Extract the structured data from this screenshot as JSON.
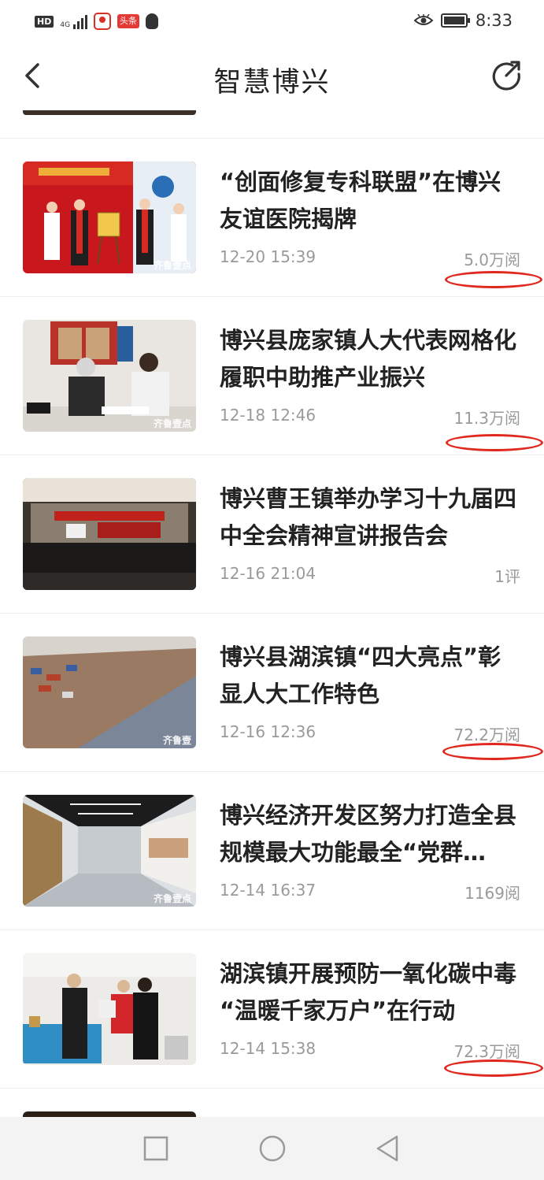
{
  "status_bar": {
    "hd": "HD",
    "network": "4G",
    "app_badge": "头条",
    "time": "8:33",
    "icons": [
      "signal-icon",
      "app-location-icon",
      "toutiao-app-icon",
      "qq-icon",
      "eye-care-icon",
      "battery-icon"
    ]
  },
  "header": {
    "title": "智慧博兴",
    "back_icon": "chevron-left-icon",
    "share_icon": "share-icon"
  },
  "news": [
    {
      "title": "“创面修复专科联盟”在博兴友谊医院揭牌",
      "date": "12-20 15:39",
      "count": "5.0万阅",
      "watermark": "齐鲁壹点",
      "highlighted": true
    },
    {
      "title": "博兴县庞家镇人大代表网格化履职中助推产业振兴",
      "date": "12-18 12:46",
      "count": "11.3万阅",
      "watermark": "齐鲁壹点",
      "highlighted": true
    },
    {
      "title": "博兴曹王镇举办学习十九届四中全会精神宣讲报告会",
      "date": "12-16 21:04",
      "count": "1评",
      "watermark": "",
      "highlighted": false
    },
    {
      "title": "博兴县湖滨镇“四大亮点”彰显人大工作特色",
      "date": "12-16 12:36",
      "count": "72.2万阅",
      "watermark": "齐鲁壹",
      "highlighted": true
    },
    {
      "title": "博兴经济开发区努力打造全县规模最大功能最全“党群…",
      "date": "12-14 16:37",
      "count": "1169阅",
      "watermark": "齐鲁壹点",
      "highlighted": false
    },
    {
      "title": "湖滨镇开展预防一氧化碳中毒 “温暖千家万户”在行动",
      "date": "12-14 15:38",
      "count": "72.3万阅",
      "watermark": "",
      "highlighted": true
    }
  ],
  "nav_bar": {
    "icons": [
      "recent-apps-icon",
      "home-icon",
      "back-triangle-icon"
    ]
  },
  "colors": {
    "highlight_mark": "#e0281e",
    "meta_text": "#9a9a9a",
    "title_text": "#222222",
    "nav_bg": "#f3f3f3"
  }
}
